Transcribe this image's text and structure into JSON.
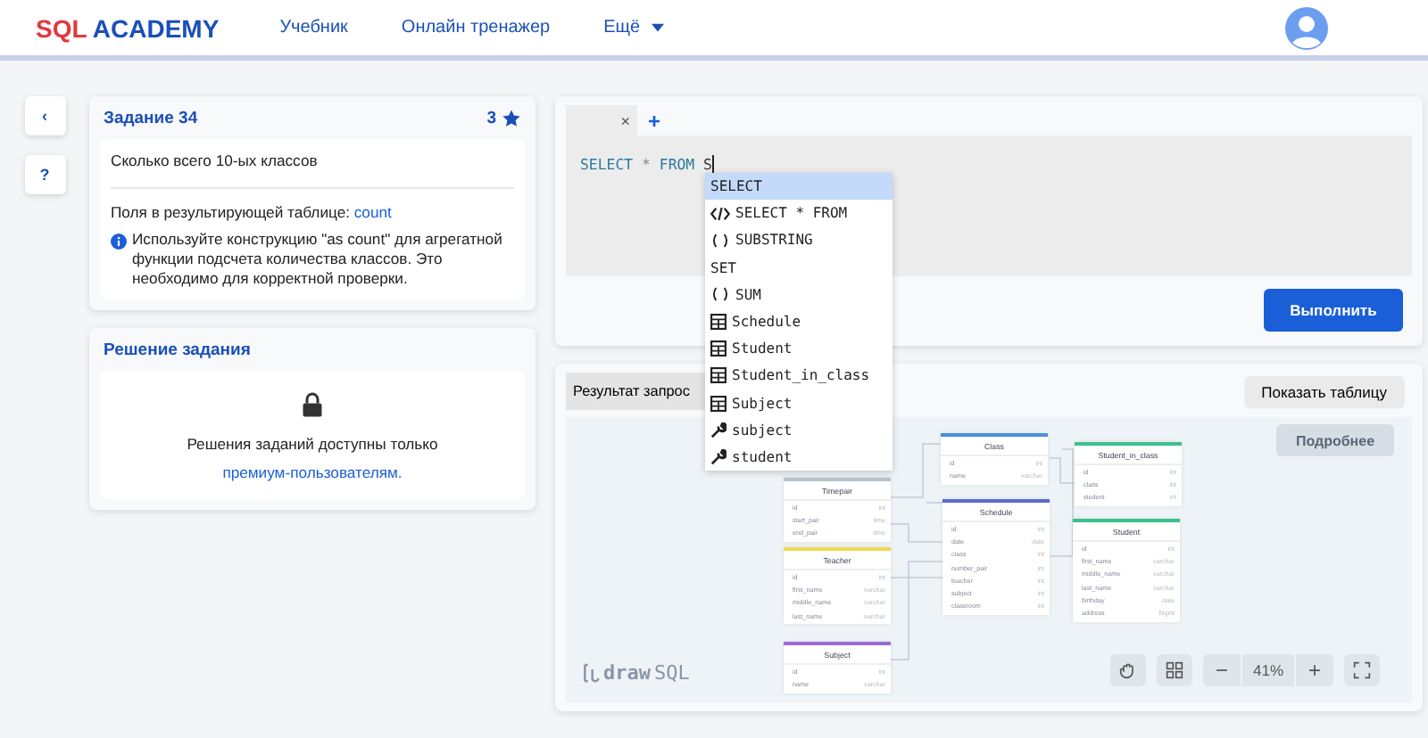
{
  "header": {
    "logo": {
      "part1": "SQL",
      "part2": "ACADEMY"
    },
    "nav": [
      {
        "label": "Учебник",
        "dropdown": false
      },
      {
        "label": "Онлайн тренажер",
        "dropdown": false
      },
      {
        "label": "Ещё",
        "dropdown": true
      }
    ]
  },
  "side_buttons": [
    "‹",
    "?"
  ],
  "task": {
    "title": "Задание 34",
    "rating": "3",
    "question": "Сколько всего 10-ых классов",
    "fields_label": "Поля в результирующей таблице:",
    "fields_value": "count",
    "hint": "Используйте конструкцию \"as count\" для агрегатной функции подсчета количества классов. Это необходимо для корректной проверки."
  },
  "solution": {
    "title": "Решение задания",
    "text": "Решения заданий доступны только",
    "link": "премиум-пользователям."
  },
  "editor": {
    "tabs": [
      {
        "close": "×",
        "selected": true
      }
    ],
    "add": "+",
    "code": [
      {
        "kind": "keyword",
        "text": "SELECT"
      },
      {
        "kind": "operator",
        "text": "*"
      },
      {
        "kind": "keyword",
        "text": "FROM"
      },
      {
        "kind": "ident",
        "text": "S"
      }
    ],
    "suggestions": [
      {
        "kind": "keyword",
        "label": "SELECT",
        "selected": true
      },
      {
        "kind": "snippet",
        "label": "SELECT * FROM",
        "selected": false
      },
      {
        "kind": "function",
        "label": "SUBSTRING",
        "selected": false
      },
      {
        "kind": "keyword",
        "label": "SET",
        "selected": false
      },
      {
        "kind": "function",
        "label": "SUM",
        "selected": false
      },
      {
        "kind": "table",
        "label": "Schedule",
        "selected": false
      },
      {
        "kind": "table",
        "label": "Student",
        "selected": false
      },
      {
        "kind": "table",
        "label": "Student_in_class",
        "selected": false
      },
      {
        "kind": "table",
        "label": "Subject",
        "selected": false
      },
      {
        "kind": "field",
        "label": "subject",
        "selected": false
      },
      {
        "kind": "field",
        "label": "student",
        "selected": false
      }
    ],
    "run_button": "Выполнить"
  },
  "result": {
    "tab": "Результат запрос",
    "show_table_button": "Показать таблицу",
    "details_button": "Подробнее",
    "brand": {
      "part1": "draw",
      "part2": "SQL"
    },
    "zoom": "41%",
    "zoom_out": "−",
    "zoom_in": "+",
    "tables": [
      {
        "name": "Class",
        "color": "#4a90d9",
        "fields": [
          {
            "name": "id",
            "type": "int"
          },
          {
            "name": "name",
            "type": "varchar"
          }
        ]
      },
      {
        "name": "Student_in_class",
        "color": "#3cc08a",
        "fields": [
          {
            "name": "id",
            "type": "int"
          },
          {
            "name": "class",
            "type": "int"
          },
          {
            "name": "student",
            "type": "int"
          }
        ]
      },
      {
        "name": "Timepair",
        "color": "#b8c2cc",
        "fields": [
          {
            "name": "id",
            "type": "int"
          },
          {
            "name": "start_pair",
            "type": "time"
          },
          {
            "name": "end_pair",
            "type": "time"
          }
        ]
      },
      {
        "name": "Schedule",
        "color": "#5b6bc9",
        "fields": [
          {
            "name": "id",
            "type": "int"
          },
          {
            "name": "date",
            "type": "date"
          },
          {
            "name": "class",
            "type": "int"
          },
          {
            "name": "number_pair",
            "type": "int"
          },
          {
            "name": "teacher",
            "type": "int"
          },
          {
            "name": "subject",
            "type": "int"
          },
          {
            "name": "classroom",
            "type": "int"
          }
        ]
      },
      {
        "name": "Student",
        "color": "#3cc08a",
        "fields": [
          {
            "name": "id",
            "type": "int"
          },
          {
            "name": "first_name",
            "type": "varchar"
          },
          {
            "name": "middle_name",
            "type": "varchar"
          },
          {
            "name": "last_name",
            "type": "varchar"
          },
          {
            "name": "birthday",
            "type": "date"
          },
          {
            "name": "address",
            "type": "bigint"
          }
        ]
      },
      {
        "name": "Teacher",
        "color": "#f2d94e",
        "fields": [
          {
            "name": "id",
            "type": "int"
          },
          {
            "name": "first_name",
            "type": "varchar"
          },
          {
            "name": "middle_name",
            "type": "varchar"
          },
          {
            "name": "last_name",
            "type": "varchar"
          }
        ]
      },
      {
        "name": "Subject",
        "color": "#9b6bd6",
        "fields": [
          {
            "name": "id",
            "type": "int"
          },
          {
            "name": "name",
            "type": "varchar"
          }
        ]
      }
    ]
  }
}
